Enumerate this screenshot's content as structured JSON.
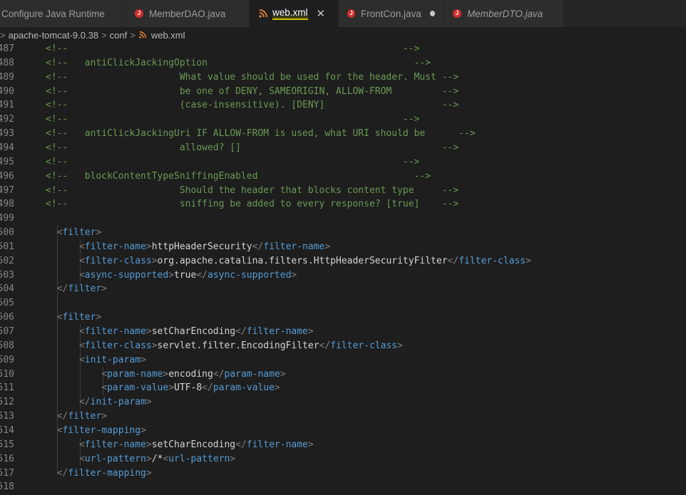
{
  "tabs": [
    {
      "label": "Configure Java Runtime",
      "icon": "none",
      "active": false,
      "state": "plain"
    },
    {
      "label": "MemberDAO.java",
      "icon": "java-icon",
      "active": false,
      "state": "plain"
    },
    {
      "label": "web.xml",
      "icon": "xml-feed-icon",
      "active": true,
      "state": "close"
    },
    {
      "label": "FrontCon.java",
      "icon": "java-icon",
      "active": false,
      "state": "dirty"
    },
    {
      "label": "MemberDTO.java",
      "icon": "java-icon",
      "active": false,
      "state": "italic"
    }
  ],
  "breadcrumb": [
    "apache-tomcat-9.0.38",
    "conf",
    "web.xml"
  ],
  "colors": {
    "comment": "#6a9955",
    "tag": "#569cd6",
    "punct": "#808080",
    "text": "#d4d4d4",
    "java_icon": "#cf2e2e",
    "xml_icon": "#e8833a"
  },
  "lines": [
    {
      "n": "487",
      "code": "<!--                                                            -->"
    },
    {
      "n": "488",
      "code": "<!--   antiClickJackingOption                                     -->"
    },
    {
      "n": "489",
      "code": "<!--                    What value should be used for the header. Must -->"
    },
    {
      "n": "490",
      "code": "<!--                    be one of DENY, SAMEORIGIN, ALLOW-FROM         -->"
    },
    {
      "n": "491",
      "code": "<!--                    (case-insensitive). [DENY]                     -->"
    },
    {
      "n": "492",
      "code": "<!--                                                            -->"
    },
    {
      "n": "493",
      "code": "<!--   antiClickJackingUri IF ALLOW-FROM is used, what URI should be      -->"
    },
    {
      "n": "494",
      "code": "<!--                    allowed? []                                    -->"
    },
    {
      "n": "495",
      "code": "<!--                                                            -->"
    },
    {
      "n": "496",
      "code": "<!--   blockContentTypeSniffingEnabled                            -->"
    },
    {
      "n": "497",
      "code": "<!--                    Should the header that blocks content type     -->"
    },
    {
      "n": "498",
      "code": "<!--                    sniffing be added to every response? [true]    -->"
    },
    {
      "n": "499",
      "code": ""
    },
    {
      "n": "500",
      "code": "  <filter>"
    },
    {
      "n": "501",
      "code": "      <filter-name>httpHeaderSecurity</filter-name>"
    },
    {
      "n": "502",
      "code": "      <filter-class>org.apache.catalina.filters.HttpHeaderSecurityFilter</filter-class>"
    },
    {
      "n": "503",
      "code": "      <async-supported>true</async-supported>"
    },
    {
      "n": "504",
      "code": "  </filter>"
    },
    {
      "n": "505",
      "code": ""
    },
    {
      "n": "506",
      "code": "  <filter>"
    },
    {
      "n": "507",
      "code": "      <filter-name>setCharEncoding</filter-name>"
    },
    {
      "n": "508",
      "code": "      <filter-class>servlet.filter.EncodingFilter</filter-class>"
    },
    {
      "n": "509",
      "code": "      <init-param>"
    },
    {
      "n": "510",
      "code": "          <param-name>encoding</param-name>"
    },
    {
      "n": "511",
      "code": "          <param-value>UTF-8</param-value>"
    },
    {
      "n": "512",
      "code": "      </init-param>"
    },
    {
      "n": "513",
      "code": "  </filter>"
    },
    {
      "n": "514",
      "code": "  <filter-mapping>"
    },
    {
      "n": "515",
      "code": "      <filter-name>setCharEncoding</filter-name>"
    },
    {
      "n": "516",
      "code": "      <url-pattern>/*<url-pattern>"
    },
    {
      "n": "517",
      "code": "  </filter-mapping>"
    },
    {
      "n": "518",
      "code": ""
    }
  ]
}
